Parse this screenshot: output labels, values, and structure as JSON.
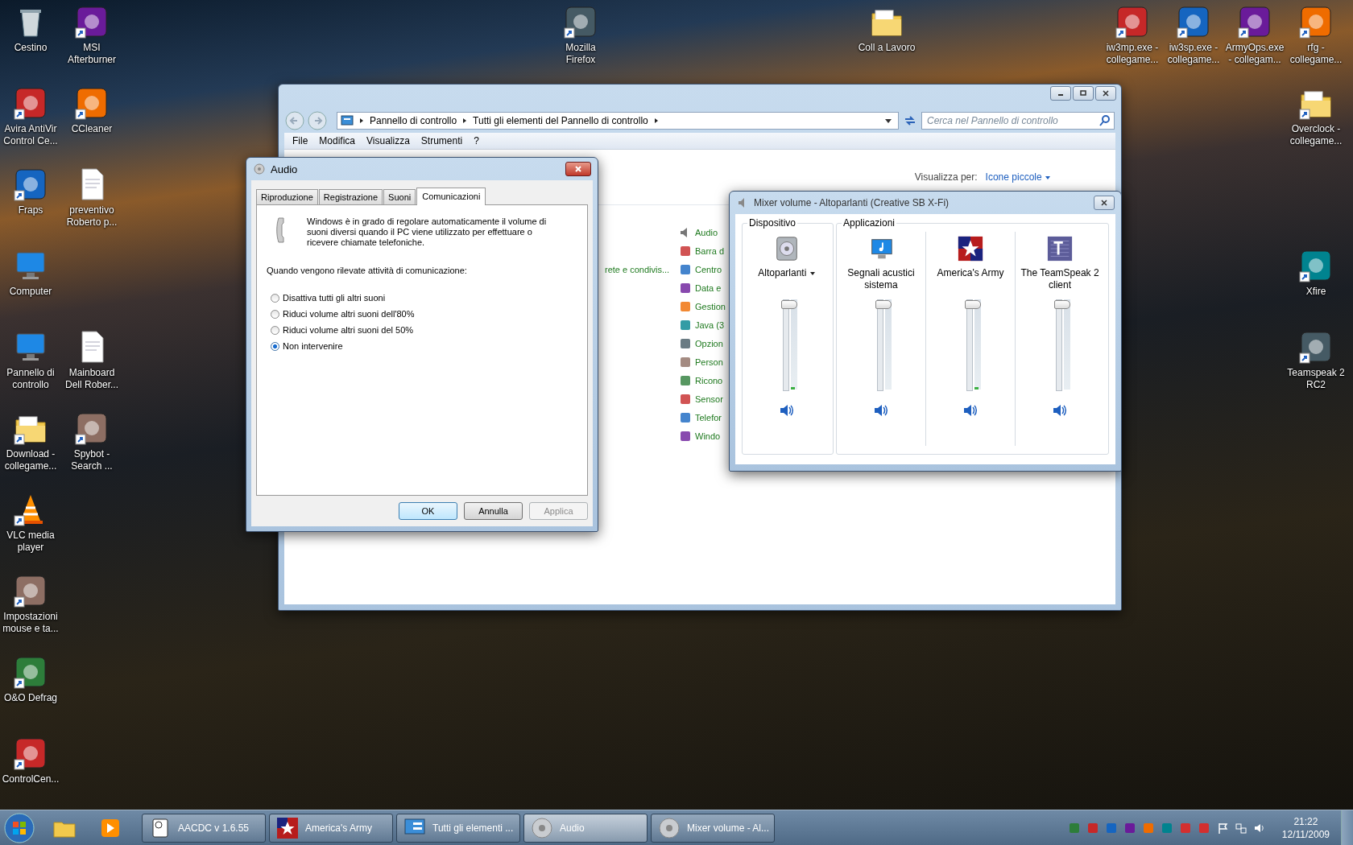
{
  "desktop": {
    "left_column": [
      {
        "label": "Cestino",
        "kind": "trash",
        "shortcut": false
      },
      {
        "label": "Avira AntiVir Control Ce...",
        "kind": "app",
        "shortcut": true
      },
      {
        "label": "Fraps",
        "kind": "app",
        "shortcut": true
      },
      {
        "label": "Computer",
        "kind": "monitor",
        "shortcut": false
      },
      {
        "label": "Pannello di controllo",
        "kind": "monitor",
        "shortcut": false
      },
      {
        "label": "Download - collegame...",
        "kind": "folder",
        "shortcut": true
      },
      {
        "label": "VLC media player",
        "kind": "cone",
        "shortcut": true
      },
      {
        "label": "Impostazioni mouse e ta...",
        "kind": "app",
        "shortcut": true
      },
      {
        "label": "O&O Defrag",
        "kind": "app",
        "shortcut": true
      },
      {
        "label": "ControlCen...",
        "kind": "app",
        "shortcut": true
      }
    ],
    "second_column": [
      {
        "label": "MSI Afterburner",
        "kind": "app",
        "shortcut": true
      },
      {
        "label": "CCleaner",
        "kind": "app",
        "shortcut": true
      },
      {
        "label": "preventivo Roberto p...",
        "kind": "document",
        "shortcut": false
      },
      {
        "label": "Mainboard Dell Rober...",
        "kind": "document",
        "shortcut": false
      },
      {
        "label": "Spybot - Search ...",
        "kind": "app",
        "shortcut": true
      }
    ],
    "top_center": [
      {
        "label": "Mozilla Firefox",
        "kind": "app",
        "shortcut": true
      },
      {
        "label": "Coll a Lavoro",
        "kind": "folder",
        "shortcut": false
      }
    ],
    "top_right": [
      {
        "label": "iw3mp.exe - collegame...",
        "kind": "app",
        "shortcut": true
      },
      {
        "label": "iw3sp.exe - collegame...",
        "kind": "app",
        "shortcut": true
      },
      {
        "label": "ArmyOps.exe - collegam...",
        "kind": "app",
        "shortcut": true
      },
      {
        "label": "rfg - collegame...",
        "kind": "app",
        "shortcut": true
      }
    ],
    "right_column": [
      {
        "label": "Overclock - collegame...",
        "kind": "folder",
        "shortcut": true
      },
      {
        "label": "Xfire",
        "kind": "app",
        "shortcut": true
      },
      {
        "label": "Teamspeak 2 RC2",
        "kind": "app",
        "shortcut": true
      }
    ]
  },
  "control_panel": {
    "breadcrumb": [
      "Pannello di controllo",
      "Tutti gli elementi del Pannello di controllo"
    ],
    "search": {
      "placeholder": "Cerca nel Pannello di controllo"
    },
    "menu": [
      "File",
      "Modifica",
      "Visualizza",
      "Strumenti",
      "?"
    ],
    "view_by_label": "Visualizza per:",
    "view_by_value": "Icone piccole",
    "partial_item": "rete e condivis...",
    "items": [
      "Audio",
      "Barra d",
      "Centro",
      "Data e",
      "Gestion",
      "Java (3",
      "Opzion",
      "Person",
      "Ricono",
      "Sensor",
      "Telefor",
      "Windo"
    ]
  },
  "audio_dialog": {
    "title": "Audio",
    "tabs": [
      {
        "label": "Riproduzione",
        "selected": false
      },
      {
        "label": "Registrazione",
        "selected": false
      },
      {
        "label": "Suoni",
        "selected": false
      },
      {
        "label": "Comunicazioni",
        "selected": true
      }
    ],
    "description": "Windows è in grado di regolare automaticamente il volume di suoni diversi quando il PC viene utilizzato per effettuare o ricevere chiamate telefoniche.",
    "prompt": "Quando vengono rilevate attività di comunicazione:",
    "options": [
      {
        "label": "Disattiva tutti gli altri suoni",
        "selected": false
      },
      {
        "label": "Riduci volume altri suoni dell'80%",
        "selected": false
      },
      {
        "label": "Riduci volume altri suoni del 50%",
        "selected": false
      },
      {
        "label": "Non intervenire",
        "selected": true
      }
    ],
    "buttons": [
      {
        "label": "OK",
        "disabled": false
      },
      {
        "label": "Annulla",
        "disabled": false
      },
      {
        "label": "Applica",
        "disabled": true
      }
    ]
  },
  "mixer": {
    "title": "Mixer volume - Altoparlanti (Creative SB X-Fi)",
    "device_group": "Dispositivo",
    "apps_group": "Applicazioni",
    "device": {
      "name": "Altoparlanti",
      "level": 1,
      "meter": {
        "level": 0.03
      },
      "muted": false
    },
    "apps": [
      {
        "name": "Segnali acustici sistema",
        "kind": "system",
        "level": 1,
        "meter": {
          "level": 0
        },
        "muted": false
      },
      {
        "name": "America's Army",
        "kind": "star",
        "level": 1,
        "meter": {
          "level": 0.03
        },
        "muted": false
      },
      {
        "name": "The TeamSpeak 2 client",
        "kind": "ts",
        "level": 1,
        "meter": {
          "level": 0
        },
        "muted": false
      }
    ]
  },
  "taskbar": {
    "tasks": [
      {
        "label": "AACDC v 1.6.55",
        "kind": "roll",
        "selected": false
      },
      {
        "label": "America's Army",
        "kind": "star",
        "selected": false
      },
      {
        "label": "Tutti gli elementi ...",
        "kind": "panel",
        "selected": false
      },
      {
        "label": "Audio",
        "kind": "speaker",
        "selected": true
      },
      {
        "label": "Mixer volume - Al...",
        "kind": "speaker",
        "selected": false
      }
    ],
    "time": "21:22",
    "date": "12/11/2009"
  }
}
